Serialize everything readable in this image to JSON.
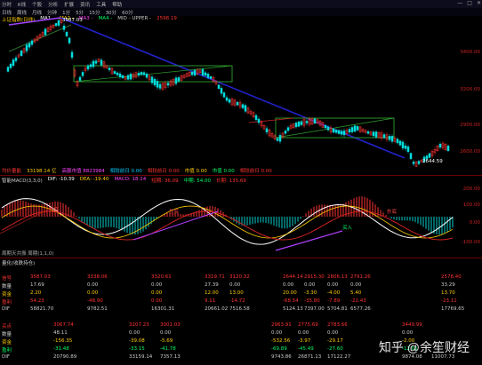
{
  "menu": [
    "分时",
    "K线",
    "个股",
    "分析",
    "扩展",
    "资讯",
    "工具",
    "帮助"
  ],
  "window_controls": [
    "—",
    "□",
    "✕"
  ],
  "tabs": [
    "日线",
    "周线",
    "月线",
    "分钟",
    "1分",
    "5分",
    "15分",
    "30分",
    "60分"
  ],
  "chart_header": {
    "code_label": "上证指数(日线)",
    "ma_labels": [
      {
        "text": "MA1 -",
        "color": "#ffffff"
      },
      {
        "text": "MA2 -",
        "color": "#ffcc00"
      },
      {
        "text": "MA3 -",
        "color": "#ff44ff"
      },
      {
        "text": "MA4 -",
        "color": "#00ff66"
      },
      {
        "text": "MID - UPPER -",
        "color": "#cccccc"
      },
      {
        "text": "2598.19",
        "color": "#ff3333"
      }
    ],
    "peak_label": "3587.03",
    "low_label": "2644.59",
    "price_ticks": [
      "3400.00",
      "3200.00",
      "2900.00",
      "2600.00"
    ]
  },
  "volume_bar": {
    "items": [
      {
        "text": "均价量能",
        "color": "#ff3333"
      },
      {
        "text": "33198.14 亿",
        "color": "#ffcc00"
      },
      {
        "text": "高额市值 8823984",
        "color": "#ff44ff"
      },
      {
        "text": "相较前日 0.00",
        "color": "#00ccff"
      },
      {
        "text": "相较前日 0.00",
        "color": "#ff3333"
      },
      {
        "text": "市值 0.00",
        "color": "#ffcc00"
      },
      {
        "text": "市值 0.00",
        "color": "#00ff66"
      },
      {
        "text": "相较前日 0.00",
        "color": "#ff3333"
      }
    ]
  },
  "macd_header": {
    "items": [
      {
        "text": "智能MACD(3,3,0)",
        "color": "#cccccc"
      },
      {
        "text": "DIF: -10.39",
        "color": "#ffffff"
      },
      {
        "text": "DEA: -19.40",
        "color": "#ffcc00"
      },
      {
        "text": "MACD: 18.14",
        "color": "#ff44ff"
      },
      {
        "text": "短期: 36.09",
        "color": "#ff3333"
      },
      {
        "text": "中期: 54.00",
        "color": "#00ff66"
      },
      {
        "text": "长期: 135.69",
        "color": "#ff3333"
      }
    ],
    "ticks": [
      "200.00",
      "100.00",
      "0.00",
      "-100.00"
    ],
    "markers": [
      "抄底",
      "抄底",
      "抄底",
      "买入"
    ]
  },
  "macd_footer": "周期天共振 周期(1,1,0)",
  "panel_header": "量化(收跌持仓)",
  "stats_top": {
    "section_labels": [
      "信号",
      "日期",
      "买入价",
      "卖出价",
      "盈亏"
    ],
    "rows": [
      {
        "label": "信号",
        "color": "#ff3333",
        "values": [
          "3587.03",
          "3338.06",
          "3320.61",
          "3319.71",
          "3120.32",
          "2644.14",
          "2915.30",
          "2806.13",
          "2791.26",
          "2578.40"
        ]
      },
      {
        "label": "数量",
        "color": "#cccccc",
        "values": [
          "17.69",
          "0.00",
          "0.00",
          "27.39",
          "0.00",
          "0.00",
          "0.00",
          "0.00",
          "0.00",
          "33.29"
        ]
      },
      {
        "label": "资金",
        "color": "#ffcc00",
        "values": [
          "2.20",
          "0.00",
          "0.00",
          "12.00",
          "13.00",
          "20.00",
          "-3.30",
          "-4.00",
          "5.40",
          "13.70"
        ]
      },
      {
        "label": "盈利",
        "color": "#ff3333",
        "values": [
          "54.23",
          "-48.90",
          "0.00",
          "9.11",
          "-14.72",
          "-68.54",
          "-35.80",
          "-7.89",
          "-22.43",
          "-23.11"
        ]
      },
      {
        "label": "DIF",
        "color": "#cccccc",
        "values": [
          "58821.70",
          "9782.51",
          "16301.31",
          "20661.02",
          "7516.58",
          "5124.13",
          "7397.00",
          "5704.81",
          "6577.26",
          "17769.65"
        ]
      }
    ]
  },
  "stats_bottom": {
    "rows": [
      {
        "label": "买点",
        "color": "#ff3333",
        "values": [
          "3067.74",
          "3207.23",
          "3001.03",
          "2963.91",
          "2775.69",
          "2783.66",
          "3449.99"
        ]
      },
      {
        "label": "数量",
        "color": "#cccccc",
        "values": [
          "48.11",
          "0.00",
          "0.00",
          "0.00",
          "0.00",
          "0.00",
          "0.00"
        ]
      },
      {
        "label": "资金",
        "color": "#ffcc00",
        "values": [
          "-156.35",
          "-39.08",
          "-5.69",
          "-532.56",
          "-3.97",
          "-29.17",
          "-2.00"
        ]
      },
      {
        "label": "盈利",
        "color": "#00ff66",
        "values": [
          "-31.48",
          "-33.15",
          "-41.78",
          "-69.89",
          "-45.49",
          "-27.60",
          "-12.01"
        ]
      },
      {
        "label": "DIF",
        "color": "#cccccc",
        "values": [
          "20790.89",
          "33159.14",
          "7357.13",
          "9743.86",
          "26871.13",
          "17122.27",
          "9874.08",
          "11007.73"
        ]
      }
    ]
  },
  "watermark": {
    "text": "知乎 @余笙财经"
  }
}
